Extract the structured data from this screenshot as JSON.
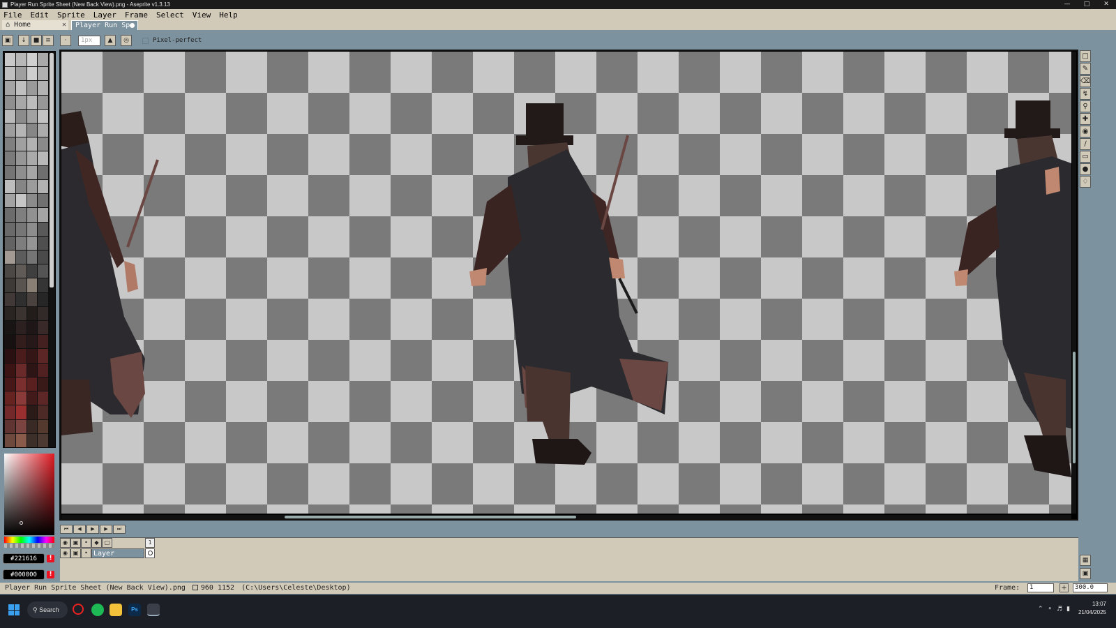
{
  "window": {
    "title": "Player Run Sprite Sheet (New Back View).png - Aseprite v1.3.13",
    "controls": [
      "—",
      "□",
      "✕"
    ]
  },
  "menu": [
    "File",
    "Edit",
    "Sprite",
    "Layer",
    "Frame",
    "Select",
    "View",
    "Help"
  ],
  "tabs": {
    "home": {
      "label": "Home",
      "close": "✕"
    },
    "active": {
      "label": "Player Run Spr"
    }
  },
  "context_bar": {
    "brush_size": "1px",
    "pixel_perfect_label": "Pixel-perfect"
  },
  "colors": {
    "foreground": "#221616",
    "background": "#000000",
    "warn_glyph": "!"
  },
  "timeline": {
    "frame_number": "1",
    "layer_name": "Layer"
  },
  "status": {
    "filename": "Player Run Sprite Sheet (New Back View).png",
    "size": "960 1152",
    "path": "(C:\\Users\\Celeste\\Desktop)",
    "frame_label": "Frame:",
    "frame_value": "1",
    "zoom": "300.0"
  },
  "taskbar": {
    "search": "Search",
    "time": "13:07",
    "date": "21/04/2025"
  },
  "palette_colors": [
    "#c9c9c9",
    "#b7b7b7",
    "#d0d0d0",
    "#a9a9a9",
    "#bfbfbf",
    "#9f9f9f",
    "#cfcfcf",
    "#b0b0b0",
    "#a5a5a5",
    "#c0c0c0",
    "#9a9a9a",
    "#b3b3b3",
    "#8f8f8f",
    "#a8a8a8",
    "#bcbcbc",
    "#979797",
    "#b9b9b9",
    "#8c8c8c",
    "#a2a2a2",
    "#c3c3c3",
    "#9d9d9d",
    "#b5b5b5",
    "#868686",
    "#ababab",
    "#808080",
    "#a0a0a0",
    "#b2b2b2",
    "#8a8a8a",
    "#7b7b7b",
    "#969696",
    "#aaaaaa",
    "#b8b8b8",
    "#747474",
    "#8e8e8e",
    "#a6a6a6",
    "#6f6f6f",
    "#bdbdbd",
    "#858585",
    "#9c9c9c",
    "#b1b1b1",
    "#a3a3a3",
    "#c6c6c6",
    "#8b8b8b",
    "#707070",
    "#6c6c6c",
    "#7f7f7f",
    "#919191",
    "#a4a4a4",
    "#6a6a6a",
    "#767676",
    "#8d8d8d",
    "#595959",
    "#636363",
    "#7e7e7e",
    "#959595",
    "#4f4f4f",
    "#a39b93",
    "#5c5c5c",
    "#757575",
    "#4a4a4a",
    "#4b4846",
    "#615b57",
    "#3f3f3f",
    "#545454",
    "#3d3a38",
    "#5a5450",
    "#8a7f74",
    "#353535",
    "#403937",
    "#2f2f2f",
    "#4a423e",
    "#262626",
    "#2a2523",
    "#3a3330",
    "#221d1b",
    "#312a28",
    "#1a1515",
    "#2c2020",
    "#1f1717",
    "#3a2929",
    "#181111",
    "#321c1c",
    "#261818",
    "#442020",
    "#2a1010",
    "#4a1c1c",
    "#341616",
    "#5c2626",
    "#3c1414",
    "#6a2a2a",
    "#2e1515",
    "#512020",
    "#481818",
    "#7a2e2e",
    "#5a1f1f",
    "#3a1919",
    "#66231f",
    "#8b3a3a",
    "#431a1a",
    "#5e2727",
    "#732929",
    "#992f2f",
    "#2a1a18",
    "#4e2a26",
    "#603430",
    "#7c4440",
    "#3a2a26",
    "#54392f",
    "#6e4a3e",
    "#8a5a4a",
    "#3c2e29",
    "#4c3a32"
  ]
}
